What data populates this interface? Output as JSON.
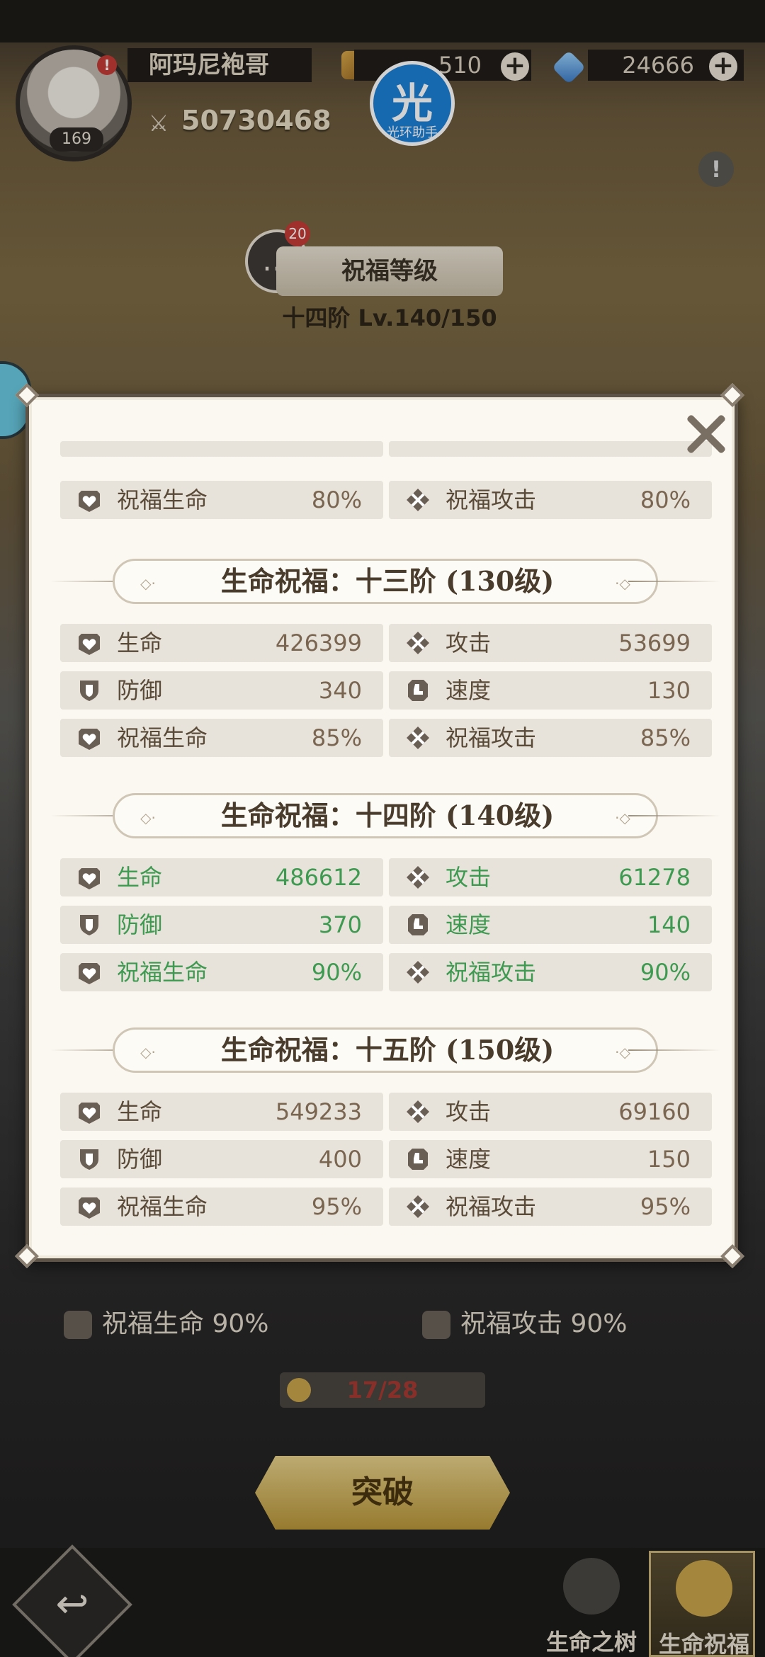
{
  "header": {
    "player_name": "阿玛尼袍哥",
    "player_level": "169",
    "avatar_badge": "!",
    "currency_scroll": "510",
    "currency_gem": "24666",
    "power": "50730468",
    "helper_glyph": "光",
    "helper_text": "光环助手",
    "info_glyph": "!"
  },
  "blessing": {
    "chat_count": "20",
    "title": "祝福等级",
    "level_text": "十四阶 Lv.140/150"
  },
  "modal": {
    "tiers": [
      {
        "title": "生命祝福：十三阶 (130级)",
        "highlight": false,
        "stats": [
          {
            "icon": "heart-icon",
            "name": "生命",
            "value": "426399"
          },
          {
            "icon": "crossed-swords-icon",
            "name": "攻击",
            "value": "53699"
          },
          {
            "icon": "shield-icon",
            "name": "防御",
            "value": "340"
          },
          {
            "icon": "boot-icon",
            "name": "速度",
            "value": "130"
          },
          {
            "icon": "heart-icon",
            "name": "祝福生命",
            "value": "85%"
          },
          {
            "icon": "crossed-swords-icon",
            "name": "祝福攻击",
            "value": "85%"
          }
        ]
      },
      {
        "title": "生命祝福：十四阶 (140级)",
        "highlight": true,
        "stats": [
          {
            "icon": "heart-icon",
            "name": "生命",
            "value": "486612"
          },
          {
            "icon": "crossed-swords-icon",
            "name": "攻击",
            "value": "61278"
          },
          {
            "icon": "shield-icon",
            "name": "防御",
            "value": "370"
          },
          {
            "icon": "boot-icon",
            "name": "速度",
            "value": "140"
          },
          {
            "icon": "heart-icon",
            "name": "祝福生命",
            "value": "90%"
          },
          {
            "icon": "crossed-swords-icon",
            "name": "祝福攻击",
            "value": "90%"
          }
        ]
      },
      {
        "title": "生命祝福：十五阶 (150级)",
        "highlight": false,
        "stats": [
          {
            "icon": "heart-icon",
            "name": "生命",
            "value": "549233"
          },
          {
            "icon": "crossed-swords-icon",
            "name": "攻击",
            "value": "69160"
          },
          {
            "icon": "shield-icon",
            "name": "防御",
            "value": "400"
          },
          {
            "icon": "boot-icon",
            "name": "速度",
            "value": "150"
          },
          {
            "icon": "heart-icon",
            "name": "祝福生命",
            "value": "95%"
          },
          {
            "icon": "crossed-swords-icon",
            "name": "祝福攻击",
            "value": "95%"
          }
        ]
      }
    ],
    "partial_prev": [
      {
        "icon": "heart-icon",
        "name": "祝福生命",
        "value": "80%"
      },
      {
        "icon": "crossed-swords-icon",
        "name": "祝福攻击",
        "value": "80%"
      }
    ]
  },
  "background_panel": {
    "row_left": "祝福生命  90%",
    "row_right": "祝福攻击  90%",
    "progress": "17/28",
    "breakthrough_label": "突破"
  },
  "bottom_nav": {
    "tab_tree": "生命之树",
    "tab_blessing": "生命祝福",
    "back_glyph": "↩"
  },
  "colors": {
    "highlight_green": "#3e9a50",
    "stat_bg": "#e7e2da",
    "modal_bg": "#fbf8f1",
    "accent_gold": "#c9a44a"
  }
}
